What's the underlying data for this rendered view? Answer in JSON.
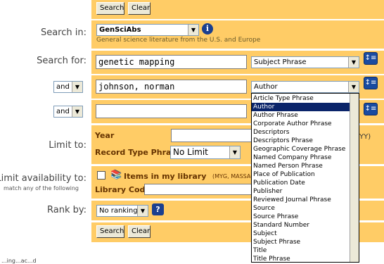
{
  "top_buttons": {
    "search": "Search",
    "clear": "Clear"
  },
  "search_in": {
    "label": "Search in:",
    "database": "GenSciAbs",
    "description": "General science literature from the U.S. and Europe"
  },
  "search_for": {
    "label": "Search for:"
  },
  "rows": [
    {
      "bool": "",
      "text": "genetic mapping",
      "field": "Subject Phrase"
    },
    {
      "bool": "and",
      "text": "johnson, norman",
      "field": "Author"
    },
    {
      "bool": "and",
      "text": "",
      "field": ""
    }
  ],
  "limit_to": {
    "label": "Limit to:",
    "year_label": "Year",
    "year_hint": "YY)",
    "record_type_label": "Record Type Phrase",
    "record_type_value": "No Limit"
  },
  "limit_availability": {
    "label": "Limit availability to:",
    "sublabel": "match any of the following",
    "items_label": "Items in my library",
    "items_codes": "(MYG, MASSACHUSE",
    "library_code_label": "Library Code"
  },
  "rank_by": {
    "label": "Rank by:",
    "value": "No ranking"
  },
  "bottom_buttons": {
    "search": "Search",
    "clear": "Clear"
  },
  "dropdown_options": [
    "Article Type Phrase",
    "Author",
    "Author Phrase",
    "Corporate Author Phrase",
    "Descriptors",
    "Descriptors Phrase",
    "Geographic Coverage Phrase",
    "Named Company Phrase",
    "Named Person Phrase",
    "Place of Publication",
    "Publication Date",
    "Publisher",
    "Reviewed Journal Phrase",
    "Source",
    "Source Phrase",
    "Standard Number",
    "Subject",
    "Subject Phrase",
    "Title",
    "Title Phrase"
  ],
  "dropdown_selected": "Author",
  "status_text": "...ing...ac...d"
}
